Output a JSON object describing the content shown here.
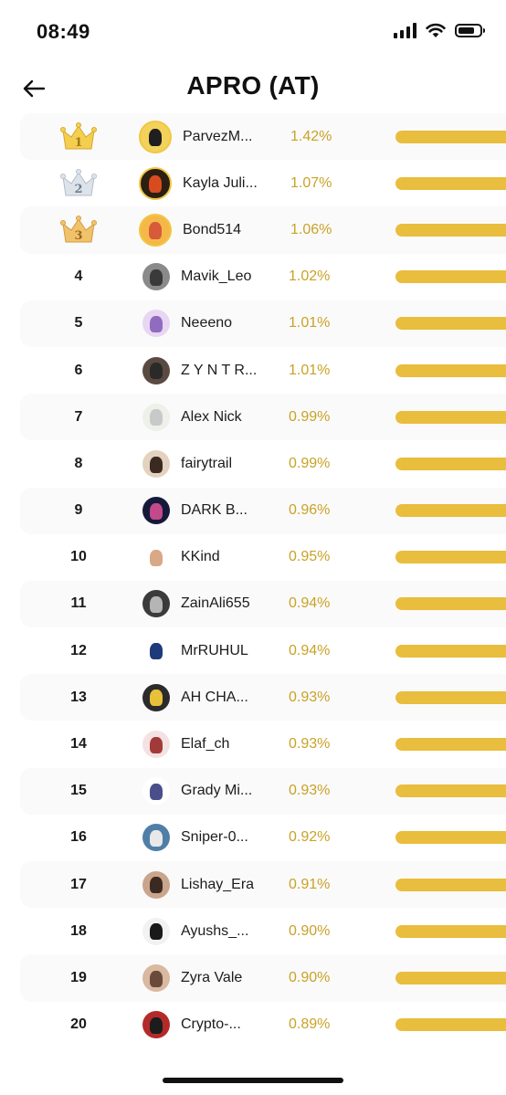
{
  "status_bar": {
    "time": "08:49"
  },
  "header": {
    "title": "APRO (AT)",
    "back_icon": "arrow-left-icon"
  },
  "leaderboard": [
    {
      "rank": "1",
      "crown": "gold",
      "name": "ParvezM...",
      "percent": "1.42%",
      "avatar_color": "#1f1f1f",
      "avatar_bg": "#f3d25a"
    },
    {
      "rank": "2",
      "crown": "silver",
      "name": "Kayla Juli...",
      "percent": "1.07%",
      "avatar_color": "#d84b1f",
      "avatar_bg": "#2b1e12"
    },
    {
      "rank": "3",
      "crown": "bronze",
      "name": "Bond514",
      "percent": "1.06%",
      "avatar_color": "#d75a3a",
      "avatar_bg": "#f5b848"
    },
    {
      "rank": "4",
      "crown": "",
      "name": "Mavik_Leo",
      "percent": "1.02%",
      "avatar_color": "#3a3a3a",
      "avatar_bg": "#8a8a8a"
    },
    {
      "rank": "5",
      "crown": "",
      "name": "Neeeno",
      "percent": "1.01%",
      "avatar_color": "#8f6cc0",
      "avatar_bg": "#e9d6f2"
    },
    {
      "rank": "6",
      "crown": "",
      "name": "Z Y N T R...",
      "percent": "1.01%",
      "avatar_color": "#2a2a2a",
      "avatar_bg": "#5a4a42"
    },
    {
      "rank": "7",
      "crown": "",
      "name": "Alex Nick",
      "percent": "0.99%",
      "avatar_color": "#c9c9c9",
      "avatar_bg": "#eef0ea"
    },
    {
      "rank": "8",
      "crown": "",
      "name": "fairytrail",
      "percent": "0.99%",
      "avatar_color": "#3b2a22",
      "avatar_bg": "#e4d2bf"
    },
    {
      "rank": "9",
      "crown": "",
      "name": "DARK B...",
      "percent": "0.96%",
      "avatar_color": "#c24a8a",
      "avatar_bg": "#151a3a"
    },
    {
      "rank": "10",
      "crown": "",
      "name": "KKind",
      "percent": "0.95%",
      "avatar_color": "#d9a887",
      "avatar_bg": "#ffffff"
    },
    {
      "rank": "11",
      "crown": "",
      "name": "ZainAli655",
      "percent": "0.94%",
      "avatar_color": "#b5b5b5",
      "avatar_bg": "#3b3b3b"
    },
    {
      "rank": "12",
      "crown": "",
      "name": "MrRUHUL",
      "percent": "0.94%",
      "avatar_color": "#1e3a7a",
      "avatar_bg": "#ffffff"
    },
    {
      "rank": "13",
      "crown": "",
      "name": "AH CHA...",
      "percent": "0.93%",
      "avatar_color": "#e8c13a",
      "avatar_bg": "#2b2b2b"
    },
    {
      "rank": "14",
      "crown": "",
      "name": "Elaf_ch",
      "percent": "0.93%",
      "avatar_color": "#a23a3a",
      "avatar_bg": "#f4e2e2"
    },
    {
      "rank": "15",
      "crown": "",
      "name": "Grady Mi...",
      "percent": "0.93%",
      "avatar_color": "#4a4f8a",
      "avatar_bg": "#ffffff"
    },
    {
      "rank": "16",
      "crown": "",
      "name": "Sniper-0...",
      "percent": "0.92%",
      "avatar_color": "#e8e8e8",
      "avatar_bg": "#4f7fa8"
    },
    {
      "rank": "17",
      "crown": "",
      "name": "Lishay_Era",
      "percent": "0.91%",
      "avatar_color": "#3a2a22",
      "avatar_bg": "#caa58c"
    },
    {
      "rank": "18",
      "crown": "",
      "name": "Ayushs_...",
      "percent": "0.90%",
      "avatar_color": "#1a1a1a",
      "avatar_bg": "#f2f2f2"
    },
    {
      "rank": "19",
      "crown": "",
      "name": "Zyra Vale",
      "percent": "0.90%",
      "avatar_color": "#6a4a3a",
      "avatar_bg": "#d9b9a0"
    },
    {
      "rank": "20",
      "crown": "",
      "name": "Crypto-...",
      "percent": "0.89%",
      "avatar_color": "#1c1c1c",
      "avatar_bg": "#b32a2a"
    }
  ],
  "colors": {
    "accent": "#e9bd3d",
    "percent_text": "#c9a227",
    "row_shade": "#fafafa"
  }
}
